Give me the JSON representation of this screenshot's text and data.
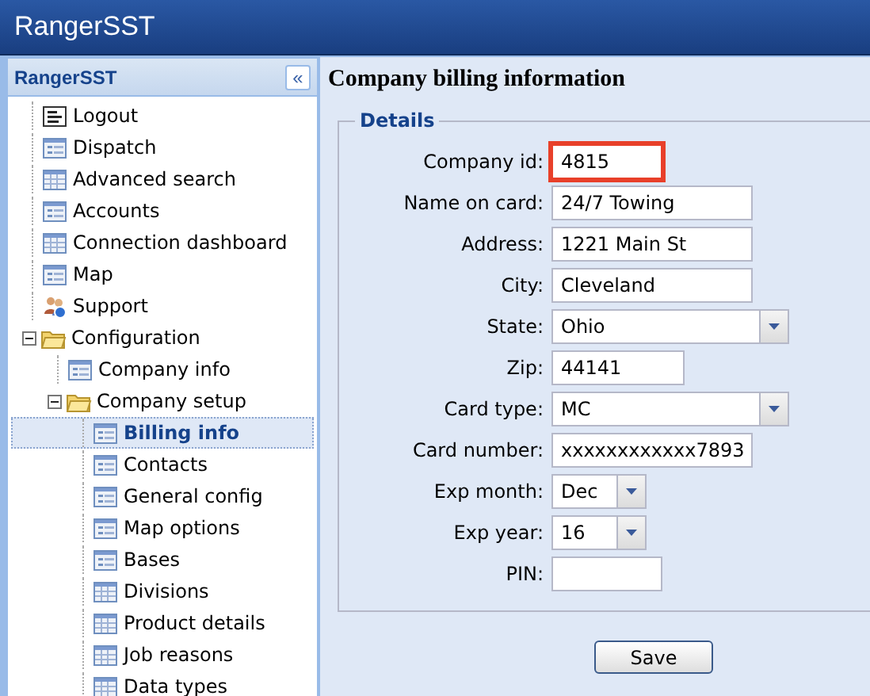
{
  "app_bar": {
    "title": "RangerSST"
  },
  "sidebar": {
    "title": "RangerSST",
    "collapse_button": "«",
    "items": [
      {
        "label": "Logout",
        "kind": "logout",
        "selected": false
      },
      {
        "label": "Dispatch",
        "kind": "form",
        "selected": false
      },
      {
        "label": "Advanced search",
        "kind": "grid",
        "selected": false
      },
      {
        "label": "Accounts",
        "kind": "form",
        "selected": false
      },
      {
        "label": "Connection dashboard",
        "kind": "grid",
        "selected": false
      },
      {
        "label": "Map",
        "kind": "form",
        "selected": false
      },
      {
        "label": "Support",
        "kind": "people",
        "selected": false
      },
      {
        "label": "Configuration",
        "kind": "folder",
        "selected": false,
        "expanded": true,
        "children": [
          {
            "label": "Company info",
            "kind": "form",
            "selected": false
          },
          {
            "label": "Company setup",
            "kind": "folder",
            "selected": false,
            "expanded": true,
            "children": [
              {
                "label": "Billing info",
                "kind": "form",
                "selected": true
              },
              {
                "label": "Contacts",
                "kind": "form",
                "selected": false
              },
              {
                "label": "General config",
                "kind": "form",
                "selected": false
              },
              {
                "label": "Map options",
                "kind": "form",
                "selected": false
              },
              {
                "label": "Bases",
                "kind": "form",
                "selected": false
              },
              {
                "label": "Divisions",
                "kind": "grid",
                "selected": false
              },
              {
                "label": "Product details",
                "kind": "grid",
                "selected": false
              },
              {
                "label": "Job reasons",
                "kind": "grid",
                "selected": false
              },
              {
                "label": "Data types",
                "kind": "grid",
                "selected": false
              }
            ]
          }
        ]
      }
    ]
  },
  "main": {
    "title": "Company billing information",
    "fieldset": {
      "legend": "Details",
      "fields": [
        {
          "label": "Company id:",
          "kind": "text",
          "value": "4815",
          "highlighted": true
        },
        {
          "label": "Name on card:",
          "kind": "text",
          "value": "24/7 Towing",
          "highlighted": false
        },
        {
          "label": "Address:",
          "kind": "text",
          "value": "1221 Main St",
          "highlighted": false
        },
        {
          "label": "City:",
          "kind": "text",
          "value": "Cleveland",
          "highlighted": false
        },
        {
          "label": "State:",
          "kind": "select",
          "value": "Ohio",
          "highlighted": false
        },
        {
          "label": "Zip:",
          "kind": "text",
          "value": "44141",
          "highlighted": false
        },
        {
          "label": "Card type:",
          "kind": "select",
          "value": "MC",
          "highlighted": false
        },
        {
          "label": "Card number:",
          "kind": "text",
          "value": "xxxxxxxxxxxx7893",
          "highlighted": false
        },
        {
          "label": "Exp month:",
          "kind": "select",
          "value": "Dec",
          "highlighted": false
        },
        {
          "label": "Exp year:",
          "kind": "select",
          "value": "16",
          "highlighted": false
        },
        {
          "label": "PIN:",
          "kind": "text",
          "highlighted": false
        }
      ]
    },
    "save_button": "Save"
  }
}
